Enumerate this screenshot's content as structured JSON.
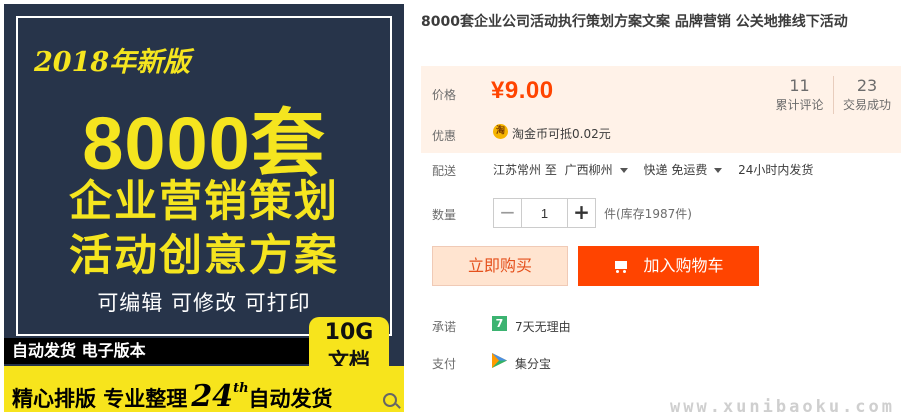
{
  "product_image": {
    "year_label": "2018年新版",
    "count": "8000套",
    "line1": "企业营销策划",
    "line2": "活动创意方案",
    "features": "可编辑 可修改 可打印",
    "badge_size": "10G",
    "badge_unit": "文档",
    "bar1": "自动发货 电子版本",
    "bar2_part1": "精心排版 专业整理",
    "bar2_num": "24",
    "bar2_sup": "th",
    "bar2_part2": "自动发货",
    "colors": {
      "background": "#27344a",
      "accent": "#f5e51f"
    }
  },
  "title": "8000套企业公司活动执行策划方案文案 品牌营销 公关地推线下活动",
  "price": {
    "label": "价格",
    "currency": "¥",
    "value": "9.00",
    "reviews_count": "11",
    "reviews_label": "累计评论",
    "trades_count": "23",
    "trades_label": "交易成功"
  },
  "promo": {
    "label": "优惠",
    "icon": "taobao-coin-icon",
    "icon_glyph": "淘",
    "text": "淘金币可抵0.02元"
  },
  "shipping": {
    "label": "配送",
    "from": "江苏常州 至",
    "to": "广西柳州",
    "method": "快递 免运费",
    "time": "24小时内发货"
  },
  "quantity": {
    "label": "数量",
    "value": "1",
    "minus": "−",
    "plus": "+",
    "stock": "件(库存1987件)"
  },
  "buttons": {
    "buy_now": "立即购买",
    "add_to_cart": "加入购物车"
  },
  "promise": {
    "label": "承诺",
    "icon_glyph": "7",
    "text": "7天无理由"
  },
  "payment": {
    "label": "支付",
    "text": "集分宝"
  },
  "watermark": "www.xunibaoku.com",
  "colors": {
    "accent": "#ff4400",
    "price": "#ff4400",
    "price_bg": "#fff2e8"
  }
}
